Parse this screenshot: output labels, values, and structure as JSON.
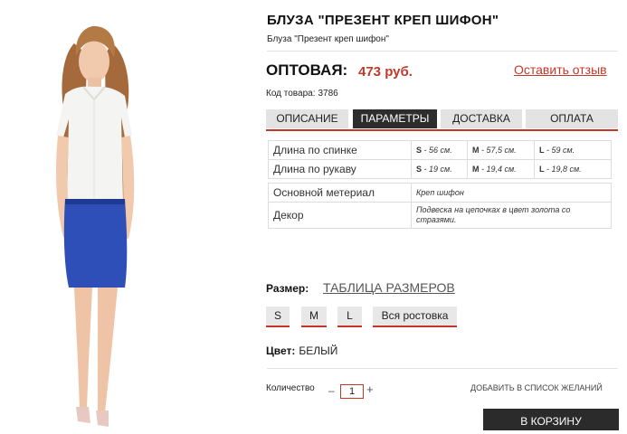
{
  "product": {
    "title": "БЛУЗА \"ПРЕЗЕНТ КРЕП ШИФОН\"",
    "subtitle": "Блуза \"Презент креп шифон\"",
    "price_label": "ОПТОВАЯ:",
    "price_value": "473 руб.",
    "review_link": "Оставить отзыв",
    "sku_label": "Код товара:",
    "sku_value": "3786"
  },
  "tabs": [
    {
      "label": "ОПИСАНИЕ",
      "active": false
    },
    {
      "label": "ПАРАМЕТРЫ",
      "active": true
    },
    {
      "label": "ДОСТАВКА",
      "active": false
    },
    {
      "label": "ОПЛАТА",
      "active": false
    }
  ],
  "params": [
    {
      "name": "Длина по спинке",
      "s": "S",
      "s_val": " - 56 см.",
      "m": "M",
      "m_val": " - 57,5 см.",
      "l": "L",
      "l_val": " - 59 см."
    },
    {
      "name": "Длина по рукаву",
      "s": "S",
      "s_val": " - 19 см.",
      "m": "M",
      "m_val": " - 19,4 см.",
      "l": "L",
      "l_val": " - 19,8 см."
    }
  ],
  "materials": [
    {
      "name": "Основной метериал",
      "value": "Креп шифон"
    },
    {
      "name": "Декор",
      "value": "Подвеска на цепочках в цвет золота со стразями."
    }
  ],
  "size": {
    "label": "Размер:",
    "table_link": "ТАБЛИЦА РАЗМЕРОВ",
    "options": [
      "S",
      "M",
      "L",
      "Вся ростовка"
    ]
  },
  "color": {
    "label": "Цвет:",
    "value": "БЕЛЫЙ"
  },
  "quantity": {
    "label": "Количество",
    "value": "1",
    "minus": "–",
    "plus": "+"
  },
  "wishlist": "ДОБАВИТЬ В СПИСОК ЖЕЛАНИЙ",
  "cart_button": "В КОРЗИНУ",
  "colors": {
    "accent": "#c0392b",
    "dark": "#2b2b2b",
    "tab_bg": "#e3e3e3"
  }
}
